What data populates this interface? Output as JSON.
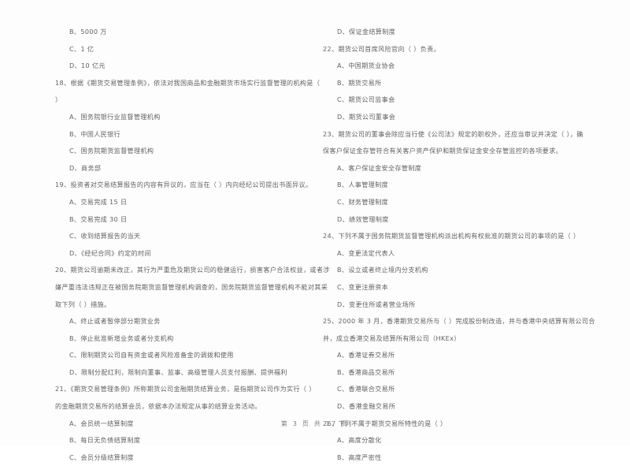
{
  "document": {
    "type": "exam-paper",
    "language": "zh-CN",
    "footer": "第 3 页 共 17 页"
  },
  "left_column": {
    "leading_options": [
      "B、5000 万",
      "C、1 亿",
      "D、10 亿元"
    ],
    "questions": [
      {
        "number": "18",
        "stem_lines": [
          "18、根据《期货交易管理条例》，依法对我国商品和金融期货市场实行监督管理的机构是（",
          "）"
        ],
        "options": [
          "A、国务院银行业监督管理机构",
          "B、中国人民银行",
          "C、国务院期货监督管理机构",
          "D、商务部"
        ]
      },
      {
        "number": "19",
        "stem_lines": [
          "19、投资者对交易结算报告的内容有异议的，应当在（      ）内向经纪公司提出书面异议。"
        ],
        "options": [
          "A、交易完成 15 日",
          "B、交易完成 30 日",
          "C、收到结算报告的当天",
          "D、《经纪合同》约定的时间"
        ]
      },
      {
        "number": "20",
        "stem_lines": [
          "20、期货公司逾期未改正，其行为严重危及期货公司的稳健运行，损害客户合法权益，或者涉",
          "嫌严重违法违规正在被国务院期货监督管理机构调查的，国务院期货监督管理机构不能对其采",
          "取下列（      ）措施。"
        ],
        "options": [
          "A、终止或者暂停部分期货业务",
          "B、停止批准新增业务或者分支机构",
          "C、限制期货公司自有资金或者风险准备金的调拨和使用",
          "D、限制分配红利，限制向董事、监事、高级管理人员支付报酬、提供福利"
        ]
      },
      {
        "number": "21",
        "stem_lines": [
          "21、《期货交易管理条例》所称期货公司金融期货结算业务，是指期货公司作为实行（      ）",
          "的金融期货交易所的结算会员，依据本办法规定从事的结算业务活动。"
        ],
        "options": [
          "A、会员统一结算制度",
          "B、每日无负债结算制度",
          "C、会员分级结算制度"
        ]
      }
    ]
  },
  "right_column": {
    "leading_options": [
      "D、保证金结算制度"
    ],
    "questions": [
      {
        "number": "22",
        "stem_lines": [
          "22、期货公司首席风险官向（      ）负责。"
        ],
        "options": [
          "A、中国期货业协会",
          "B、期货交易所",
          "C、期货公司监事会",
          "D、期货公司董事会"
        ]
      },
      {
        "number": "23",
        "stem_lines": [
          "23、期货公司的董事会除应当行使《公司法》规定的职权外，还应当审议并决定（      ），确",
          "保客户保证金存管符合有关客户资产保护和期货保证金安全存管监控的各项要求。"
        ],
        "options": [
          "A、客户保证金安全存管制度",
          "B、人事管理制度",
          "C、财务管理制度",
          "D、绩效管理制度"
        ]
      },
      {
        "number": "24",
        "stem_lines": [
          "24、下列不属于国务院期货监督管理机构派出机构有权批准的期货公司的事项的是（      ）"
        ],
        "options": [
          "A、变更法定代表人",
          "B、设立或者终止境内分支机构",
          "C、变更注册资本",
          "D、变更住所或者营业场所"
        ]
      },
      {
        "number": "25",
        "stem_lines": [
          "25、2000 年 3 月，香港期货交易所与（      ）完成股份制改造，并与香港中央结算有限公司合",
          "并，成立香港交易及结算所有限公司（HKEx）"
        ],
        "options": [
          "A、香港证券交易所",
          "B、香港商品交易所",
          "C、香港联合交易所",
          "D、香港金融交易所"
        ]
      },
      {
        "number": "26",
        "stem_lines": [
          "26、下列不属于期货交易所特性的是（      ）"
        ],
        "options": [
          "A、高度分散化",
          "B、高度严密性"
        ]
      }
    ]
  }
}
